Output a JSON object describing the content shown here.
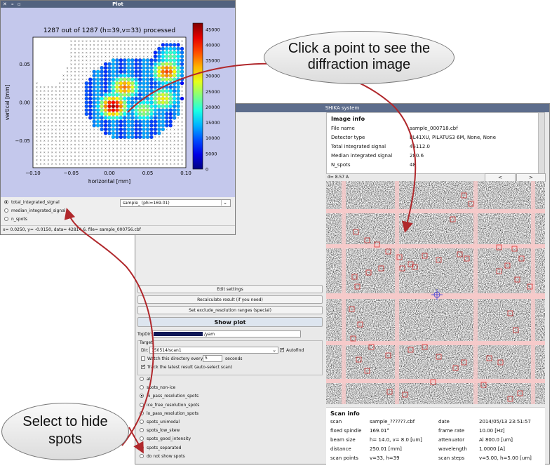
{
  "plot_window": {
    "title": "Plot",
    "chart_title": "1287 out of 1287 (h=39,v=33) processed",
    "xlabel": "horizontal [mm]",
    "ylabel": "vertical [mm]",
    "x_ticks": [
      "−0.10",
      "−0.05",
      "0.00",
      "0.05",
      "0.10"
    ],
    "y_ticks": [
      "0.05",
      "0.00",
      "−0.05"
    ],
    "colorbar_ticks": [
      "45000",
      "40000",
      "35000",
      "30000",
      "25000",
      "20000",
      "15000",
      "10000",
      "5000",
      "0"
    ],
    "radios": [
      {
        "label": "total_integrated_signal",
        "selected": true
      },
      {
        "label": "median_integrated_signal",
        "selected": false
      },
      {
        "label": "n_spots",
        "selected": false
      }
    ],
    "sample_select": "sample_ (phi=169.01)",
    "status": "x= 0.0250, y= -0.0150, data= 42814.6, file= sample_000756.cbf"
  },
  "chart_data": {
    "type": "scatter",
    "title": "1287 out of 1287 (h=39,v=33) processed",
    "xlabel": "horizontal [mm]",
    "ylabel": "vertical [mm]",
    "xlim": [
      -0.1,
      0.1
    ],
    "ylim": [
      -0.085,
      0.085
    ],
    "grid": {
      "h": 39,
      "v": 33,
      "step": 0.005
    },
    "colorbar_range": [
      0,
      47000
    ],
    "colormap": "jet",
    "hot_spots": [
      {
        "x": 0.005,
        "y": -0.005,
        "value": 45000
      },
      {
        "x": 0.02,
        "y": 0.02,
        "value": 36000
      },
      {
        "x": 0.075,
        "y": 0.04,
        "value": 38000
      },
      {
        "x": 0.07,
        "y": 0.005,
        "value": 30000
      },
      {
        "x": 0.045,
        "y": -0.01,
        "value": 26000
      },
      {
        "x": 0.08,
        "y": 0.06,
        "value": 22000
      }
    ]
  },
  "shika": {
    "title": "SHIKA system",
    "image_info": {
      "header": "Image info",
      "rows": [
        {
          "k": "File name",
          "v": "sample_000718.cbf"
        },
        {
          "k": "Detector type",
          "v": "BL41XU, PILATUS3 6M, None, None"
        },
        {
          "k": "Total integrated signal",
          "v": "45112.0"
        },
        {
          "k": "Median integrated signal",
          "v": "280.6"
        },
        {
          "k": "N_spots",
          "v": "48"
        }
      ]
    },
    "dval": "d=  8.57 A",
    "prev": "<",
    "next": ">",
    "buttons": {
      "edit": "Edit settings",
      "recalc": "Recalculate result (if you need)",
      "exclude": "Set exclude_resolution ranges (special)",
      "showplot": "Show plot"
    },
    "topdir_label": "TopDir:",
    "topdir_suffix": "/yam",
    "target_label": "Target",
    "dir_label": "Dir:",
    "dir_value": "150514/scan1",
    "autofind": "Autofind",
    "watch_label": "Watch this directory every",
    "watch_value": "5",
    "watch_unit": "seconds",
    "track_label": "Track the latest result (auto-select scan)",
    "spot_radios": [
      {
        "label": "all",
        "selected": false
      },
      {
        "label": "spots_non-ice",
        "selected": false
      },
      {
        "label": "hi_pass_resolution_spots",
        "selected": true
      },
      {
        "label": "ice_free_resolution_spots",
        "selected": false
      },
      {
        "label": "lo_pass_resolution_spots",
        "selected": false
      },
      {
        "label": "spots_unimodal",
        "selected": false
      },
      {
        "label": "spots_low_skew",
        "selected": false
      },
      {
        "label": "spots_good_intensity",
        "selected": false
      },
      {
        "label": "spots_separated",
        "selected": false
      },
      {
        "label": "do not show spots",
        "selected": false
      }
    ],
    "scan_info": {
      "header": "Scan info",
      "rows": [
        {
          "k": "scan",
          "v": "sample_??????.cbf",
          "k2": "date",
          "v2": "2014/05/13 23:51:57"
        },
        {
          "k": "fixed spindle",
          "v": "169.01°",
          "k2": "frame rate",
          "v2": "10.00 [Hz]"
        },
        {
          "k": "beam size",
          "v": "h= 14.0, v= 8.0 [um]",
          "k2": "attenuator",
          "v2": "Al 800.0 [um]"
        },
        {
          "k": "distance",
          "v": "250.01 [mm]",
          "k2": "wavelength",
          "v2": "1.0000 [A]"
        },
        {
          "k": "scan points",
          "v": "v=33, h=39",
          "k2": "scan steps",
          "v2": "v=5.00, h=5.00 [um]"
        }
      ]
    }
  },
  "callouts": {
    "click_point": "Click a point to see the diffraction image",
    "select_hide": "Select to hide spots"
  },
  "colors": {
    "arrow": "#b0282c",
    "spot_box": "#d62020",
    "gap": "#f6caca"
  }
}
